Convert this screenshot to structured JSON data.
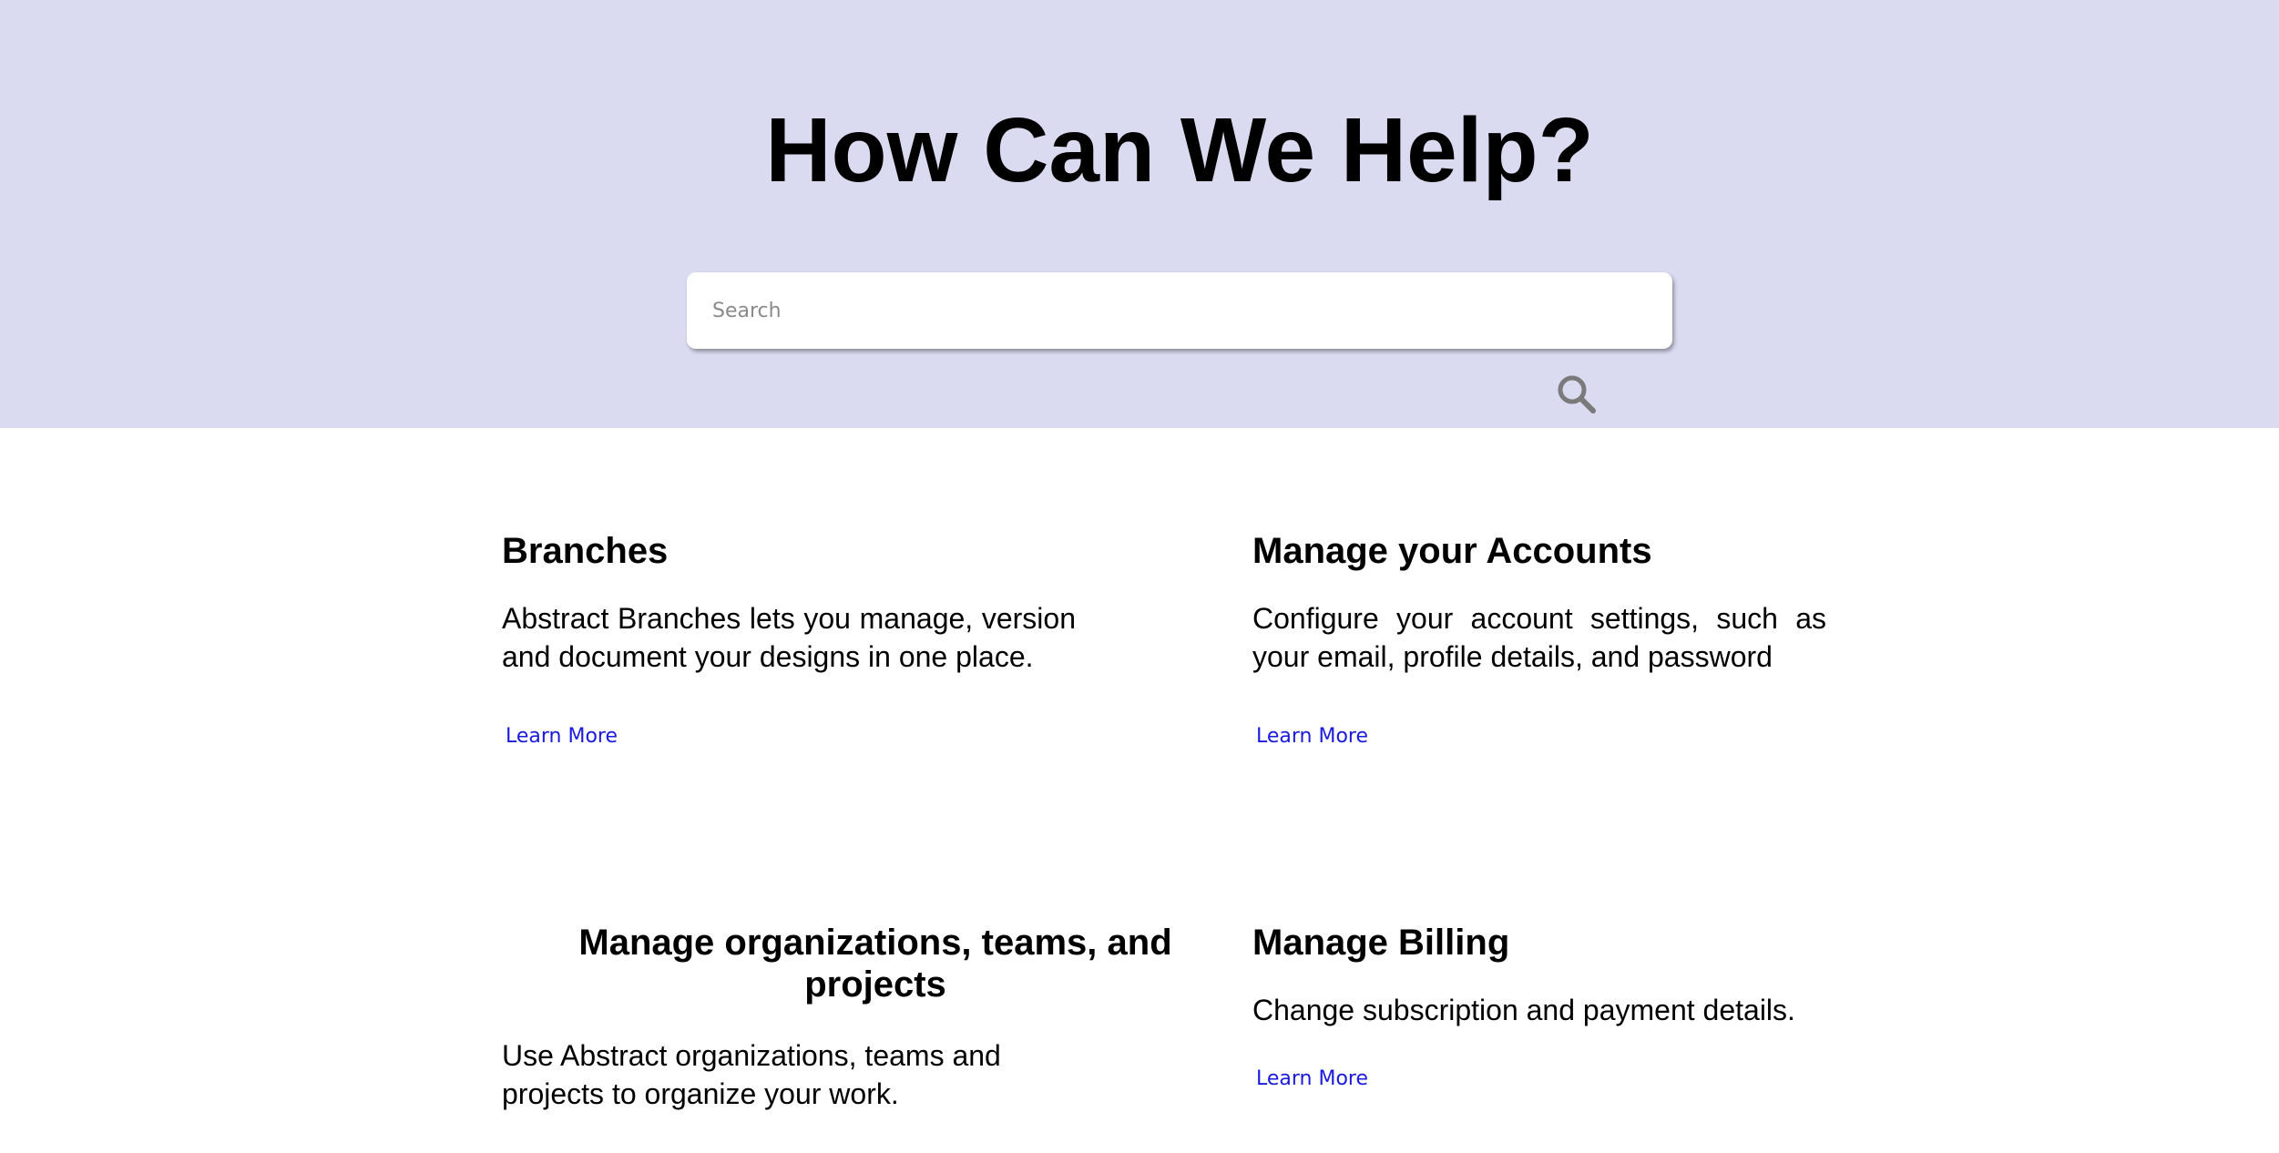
{
  "hero": {
    "title": "How Can We Help?",
    "background_color": "#dadbf0"
  },
  "search": {
    "placeholder": "Search",
    "value": "",
    "icon": "search-icon"
  },
  "cards": [
    {
      "title": "Branches",
      "description": "Abstract Branches lets you manage, version and document your designs in one place.",
      "link": "Learn More"
    },
    {
      "title": "Manage your Accounts",
      "description": "Configure your account settings, such as your email, profile details, and password",
      "link": "Learn More"
    },
    {
      "title": "Manage organizations, teams, and projects",
      "description": "Use Abstract organizations, teams and projects to organize your work."
    },
    {
      "title": "Manage Billing",
      "description": "Change subscription and payment details.",
      "link": "Learn More"
    }
  ],
  "colors": {
    "link": "#1a1adb",
    "search_icon": "#7a7a7a"
  }
}
